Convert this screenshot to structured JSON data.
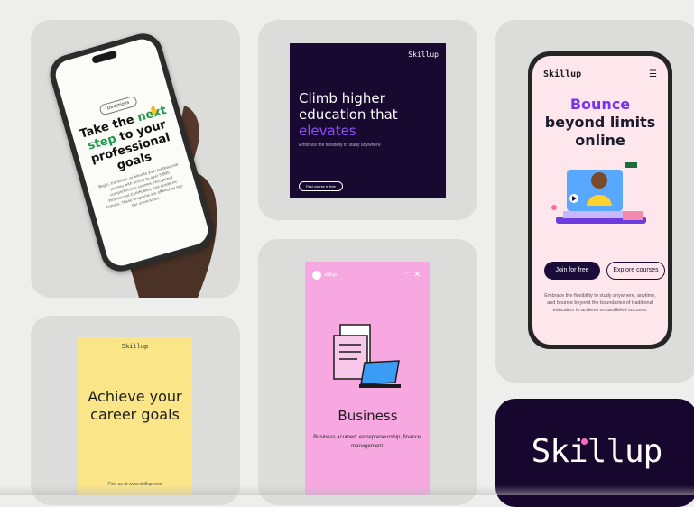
{
  "tile_phone_hand": {
    "pill": "Directions",
    "title_pre": "Take the ",
    "title_green": "next step",
    "title_post": " to your professional goals",
    "body": "Begin, transition, or elevate your professional journey with access to over 5,800 comprehensive courses, recognized Professional Certificates, and academic degrees. These programs are offered by top-tier universities."
  },
  "tile_climb": {
    "logo": "Skillup",
    "title_white": "Climb higher education that",
    "title_purple": "elevates",
    "subtitle": "Embrace the flexibility to study anywhere",
    "button": "Find course is free"
  },
  "tile_bounce": {
    "logo": "Skillup",
    "menu_icon": "hamburger-icon",
    "title_purple": "Bounce",
    "title_dark": "beyond limits online",
    "primary_button": "Join for free",
    "secondary_button": "Explore courses",
    "body": "Embrace the flexibility to study anywhere, anytime, and bounce beyond the boundaries of traditional education to achieve unparalleled success."
  },
  "tile_career": {
    "logo": "Skillup",
    "title": "Achieve your career goals",
    "footer": "Find us at www.skillup.com"
  },
  "tile_business": {
    "account_name": "skillup",
    "close_icon": "close-icon",
    "title": "Business",
    "subtitle": "Business acumen: entrepreneurship, finance, management."
  },
  "tile_logo": {
    "logo": "Skillup"
  },
  "colors": {
    "background": "#eeeeec",
    "tile": "#dcdcda",
    "navy": "#170930",
    "purple": "#7a30f0",
    "green": "#1e9a4a",
    "pink": "#f7a8e1",
    "yellow": "#fae588",
    "blush": "#fde7ec"
  }
}
